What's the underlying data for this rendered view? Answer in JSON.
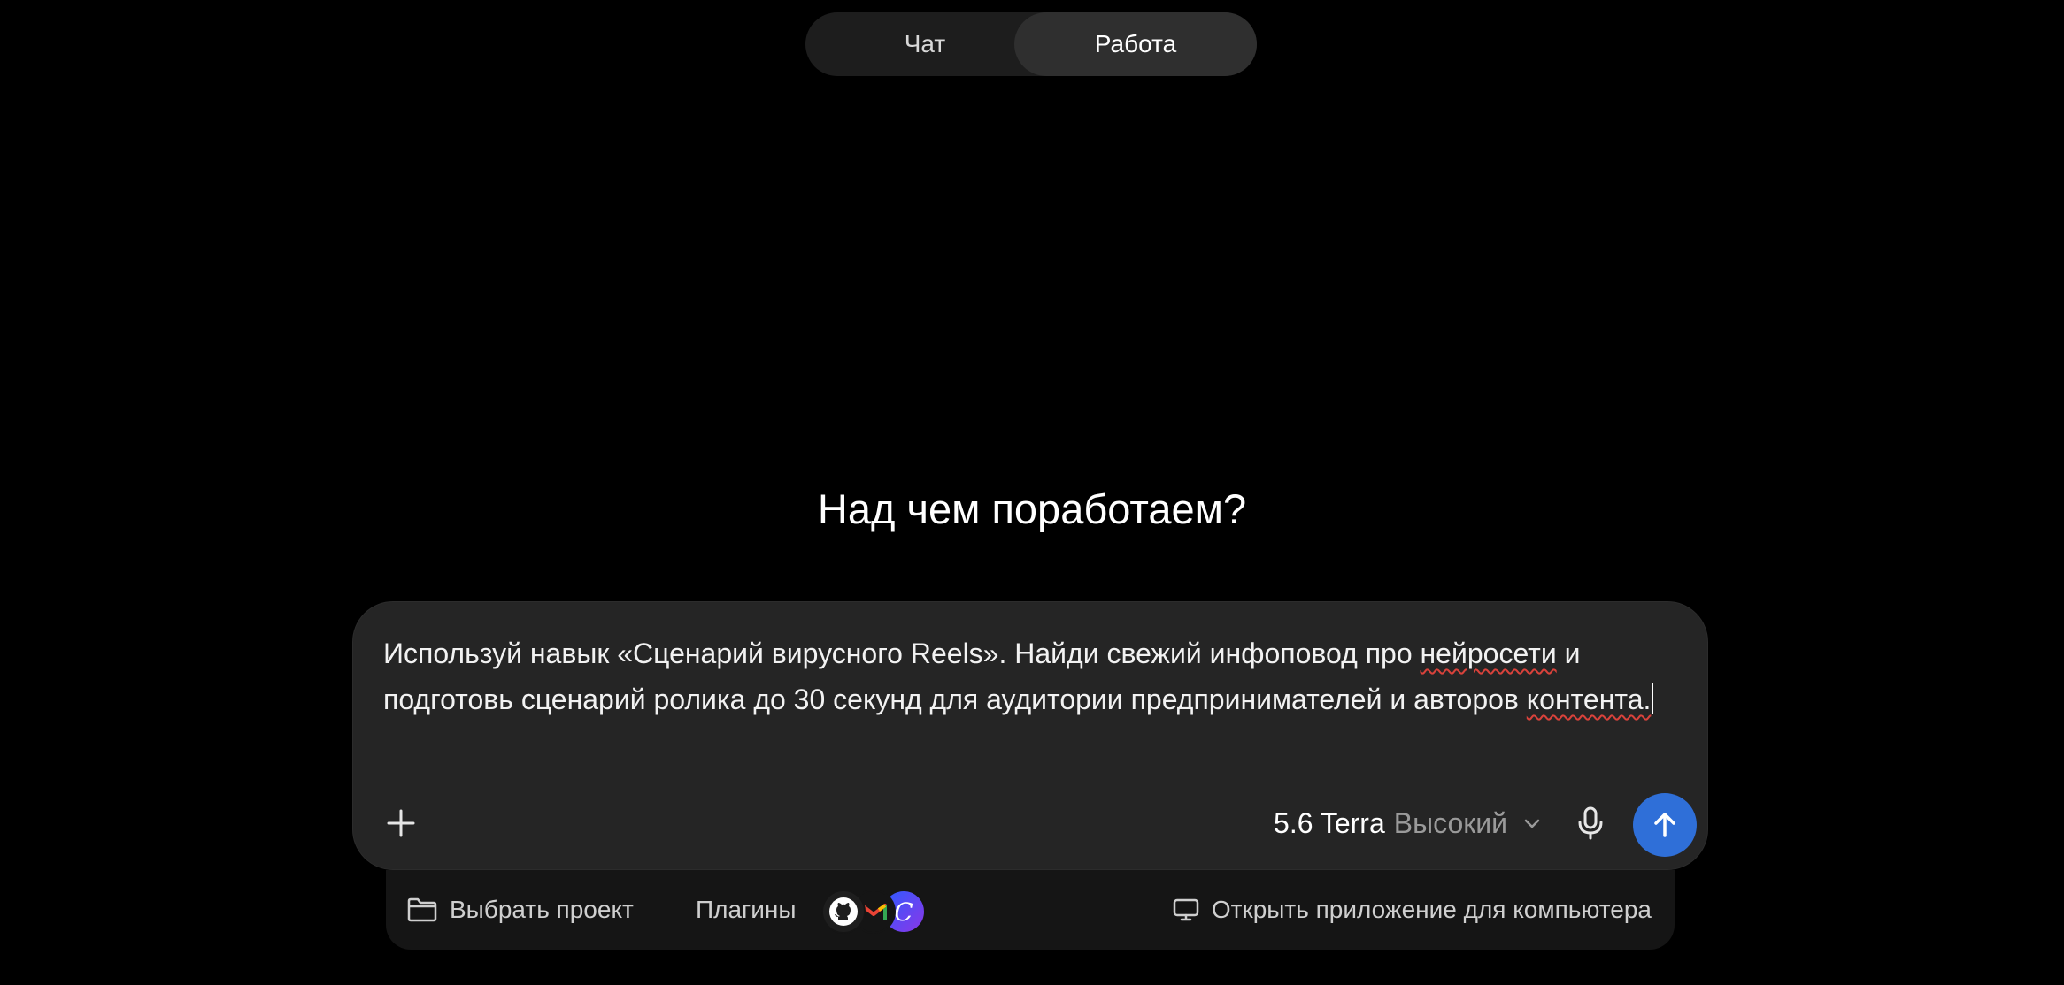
{
  "mode_toggle": {
    "tabs": [
      {
        "label": "Чат",
        "active": false
      },
      {
        "label": "Работа",
        "active": true
      }
    ]
  },
  "heading": "Над чем поработаем?",
  "composer": {
    "text_part1": "Используй навык «Сценарий вирусного Reels». Найди свежий инфоповод про ",
    "misspelled_1": "нейросети",
    "text_part2": " и подготовь сценарий ролика до 30 секунд для аудитории предпринимателей и авторов ",
    "misspelled_2": "контента.",
    "model_name": "5.6 Terra",
    "model_level": "Высокий",
    "icons": {
      "add": "plus-icon",
      "dropdown": "chevron-down-icon",
      "mic": "microphone-icon",
      "send": "arrow-up-icon"
    }
  },
  "bottom_bar": {
    "project_label": "Выбрать проект",
    "plugins_label": "Плагины",
    "plugins": [
      "github-icon",
      "gmail-icon",
      "c-plugin-icon"
    ],
    "plugin_c_letter": "C",
    "desktop_label": "Открыть приложение для компьютера"
  },
  "colors": {
    "background": "#000000",
    "composer": "#252525",
    "send_button": "#2f6fd8",
    "active_tab": "#2f2f2f"
  }
}
